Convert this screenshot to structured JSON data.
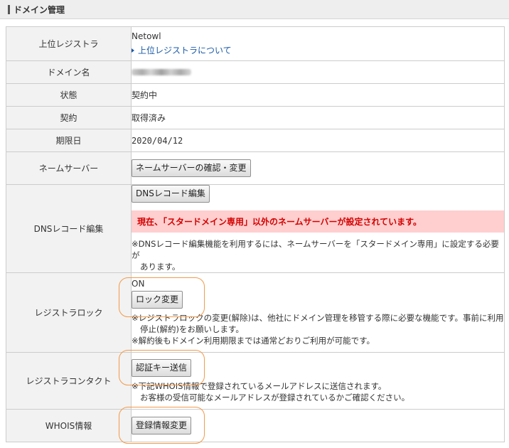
{
  "section": {
    "title": "ドメイン管理"
  },
  "rows": {
    "registrar": {
      "label": "上位レジストラ",
      "value": "Netowl",
      "link": "上位レジストラについて"
    },
    "domain": {
      "label": "ドメイン名"
    },
    "status": {
      "label": "状態",
      "value": "契約中"
    },
    "contract": {
      "label": "契約",
      "value": "取得済み"
    },
    "expiry": {
      "label": "期限日",
      "value": "2020/04/12"
    },
    "nameserver": {
      "label": "ネームサーバー",
      "button": "ネームサーバーの確認・変更"
    },
    "dns": {
      "label": "DNSレコード編集",
      "button": "DNSレコード編集",
      "warning": "現在、「スタードメイン専用」以外のネームサーバーが設定されています。",
      "note_line1": "※DNSレコード編集機能を利用するには、ネームサーバーを「スタードメイン専用」に設定する必要が",
      "note_line2": "あります。"
    },
    "lock": {
      "label": "レジストラロック",
      "state": "ON",
      "button": "ロック変更",
      "note_line1": "※レジストラロックの変更(解除)は、他社にドメイン管理を移管する際に必要な機能です。事前に利用",
      "note_line2": "停止(解約)をお願いします。",
      "note_line3": "※解約後もドメイン利用期限までは通常どおりご利用が可能です。"
    },
    "contact": {
      "label": "レジストラコンタクト",
      "button": "認証キー送信",
      "note_line1": "※下記WHOIS情報で登録されているメールアドレスに送信されます。",
      "note_line2": "お客様の受信可能なメールアドレスが登録されているかご確認ください。"
    },
    "whois": {
      "label": "WHOIS情報",
      "button": "登録情報変更"
    }
  },
  "colors": {
    "highlight_ring": "#f39a4a",
    "warning_bg": "#ffcfcf",
    "warning_text": "#d40000",
    "link": "#1a5aa8",
    "label_bg": "#f2f2f2"
  }
}
